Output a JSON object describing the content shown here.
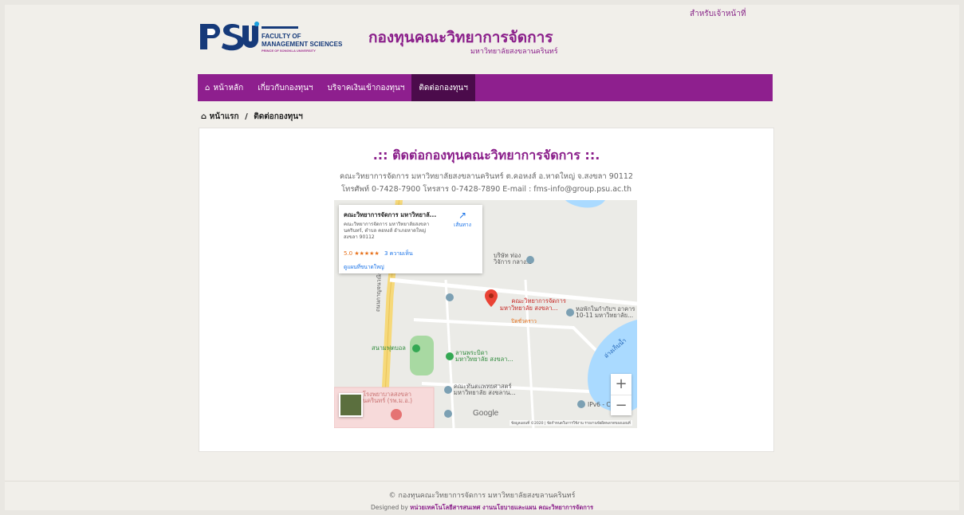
{
  "header": {
    "staff_link": "สำหรับเจ้าหน้าที่",
    "logo": {
      "mark": "PSU",
      "line1": "FACULTY OF",
      "line2": "MANAGEMENT SCIENCES",
      "line3": "PRINCE OF SONGKLA UNIVERSITY"
    },
    "title": "กองทุนคณะวิทยาการจัดการ",
    "subtitle": "มหาวิทยาลัยสงขลานครินทร์"
  },
  "nav": {
    "items": [
      {
        "label": "หน้าหลัก",
        "icon": "home-icon",
        "active": false
      },
      {
        "label": "เกี่ยวกับกองทุนฯ",
        "active": false
      },
      {
        "label": "บริจาคเงินเข้ากองทุนฯ",
        "active": false
      },
      {
        "label": "ติดต่อกองทุนฯ",
        "active": true
      }
    ],
    "accent": "#8e1f8e",
    "active_bg": "#4b0b4b"
  },
  "breadcrumb": {
    "home": "หน้าแรก",
    "separator": "/",
    "current": "ติดต่อกองทุนฯ"
  },
  "content": {
    "title": ".:: ติดต่อกองทุนคณะวิทยาการจัดการ ::.",
    "address": "คณะวิทยาการจัดการ มหาวิทยาลัยสงขลานครินทร์ ต.คอหงส์ อ.หาดใหญ่ จ.สงขลา 90112",
    "phone": "โทรศัพท์ 0-7428-7900 โทรสาร 0-7428-7890 E-mail : fms-info@group.psu.ac.th"
  },
  "map": {
    "info_card": {
      "title": "คณะวิทยาการจัดการ มหาวิทยาลั...",
      "address": "คณะวิทยาการจัดการ มหาวิทยาลัยสงขลานครินทร์, ตำบล คอหงส์ อำเภอหาดใหญ่ สงขลา 90112",
      "rating": "5.0 ★★★★★",
      "reviews": "3 ความเห็น",
      "directions": "เส้นทาง",
      "larger_map": "ดูแผนที่ขนาดใหญ่"
    },
    "labels": {
      "company": "บริษัท ท่อง\nวิจัการ กลาง...",
      "road": "ถนนกาญจนวณิชย์",
      "main_pin": "คณะวิทยาการจัดการ\nมหาวิทยาลัย สงขลา...",
      "main_pin_sub": "ปิดชั่วคราว",
      "dorm": "หอพักในกำกับฯ อาคาร\n10-11 มหาวิทยาลัย...",
      "stadium": "สนามฟุตบอล",
      "plaza": "ลานพระบิดา\nมหาวิทยาลัย สงขลา...",
      "lake": "อ่างเก็บน้ำ",
      "dentistry": "คณะทันตแพทยศาสตร์\nมหาวิทยาลัย สงขลาน...",
      "hospital": "โรงพยาบาลสงขลา\nนครินทร์ (รพ.ม.อ.)",
      "ipv6": "IPv6 - C",
      "google": "Google",
      "attribution": "ข้อมูลแผนที่ ©2020  |  ข้อกำหนดในการใช้งาน  รายงานข้อผิดพลาดของแผนที่"
    },
    "zoom_in": "+",
    "zoom_out": "−"
  },
  "footer": {
    "copyright": "© กองทุนคณะวิทยาการจัดการ มหาวิทยาลัยสงขลานครินทร์",
    "designed_prefix": "Designed by",
    "designed_by": "หน่วยเทคโนโลยีสารสนเทศ งานนโยบายและแผน คณะวิทยาการจัดการ"
  }
}
